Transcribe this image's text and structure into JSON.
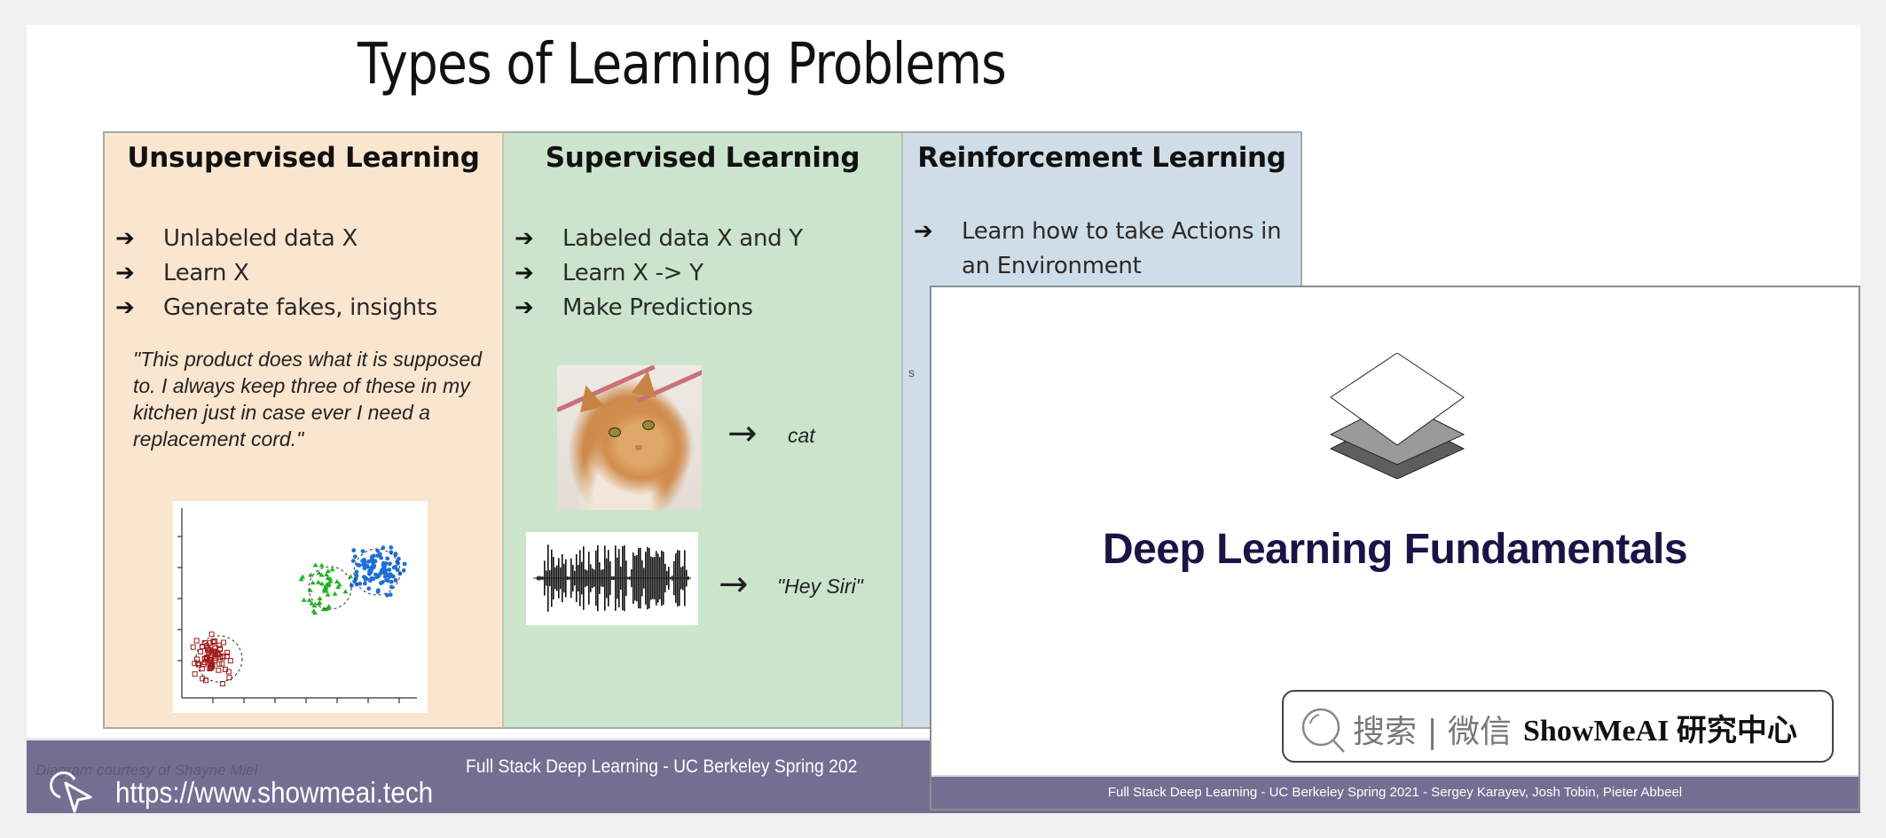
{
  "slide": {
    "title": "Types of Learning Problems",
    "columns": [
      {
        "heading": "Unsupervised Learning",
        "color": "#fae6cf",
        "bullets": [
          "Unlabeled data X",
          "Learn X",
          "Generate fakes, insights"
        ],
        "quote": "\"This product does what it is supposed to. I always keep three of these in my kitchen just in case ever I need a replacement cord.\"",
        "figure": "scatter-plot-clusters"
      },
      {
        "heading": "Supervised Learning",
        "color": "#cbe5cc",
        "bullets": [
          "Labeled data X and Y",
          "Learn X -> Y",
          "Make Predictions"
        ],
        "examples": [
          {
            "input": "cat-photo",
            "arrow": "→",
            "label": "cat"
          },
          {
            "input": "audio-waveform",
            "arrow": "→",
            "label": "\"Hey Siri\""
          }
        ]
      },
      {
        "heading": "Reinforcement Learning",
        "color": "#cfdde8",
        "bullets": [
          "Learn how to take Actions in an Environment"
        ],
        "cut_text": "s"
      }
    ],
    "bullet_glyph": "➔",
    "footer": {
      "courtesy": "Diagram courtesy of Shayne Miel",
      "text": "Full Stack Deep Learning - UC Berkeley Spring 202",
      "color": "#756e93"
    }
  },
  "watermark": {
    "url": "https://www.showmeai.tech",
    "icon": "cursor-click-icon"
  },
  "overlay": {
    "title": "Deep Learning Fundamentals",
    "title_color": "#1a1446",
    "icon": "stacked-layers-icon",
    "search": {
      "icon": "search-icon",
      "prefix": "搜索 | 微信",
      "brand": "ShowMeAI 研究中心"
    },
    "footer": "Full Stack Deep Learning - UC Berkeley Spring 2021 - Sergey Karayev, Josh Tobin, Pieter Abbeel"
  }
}
